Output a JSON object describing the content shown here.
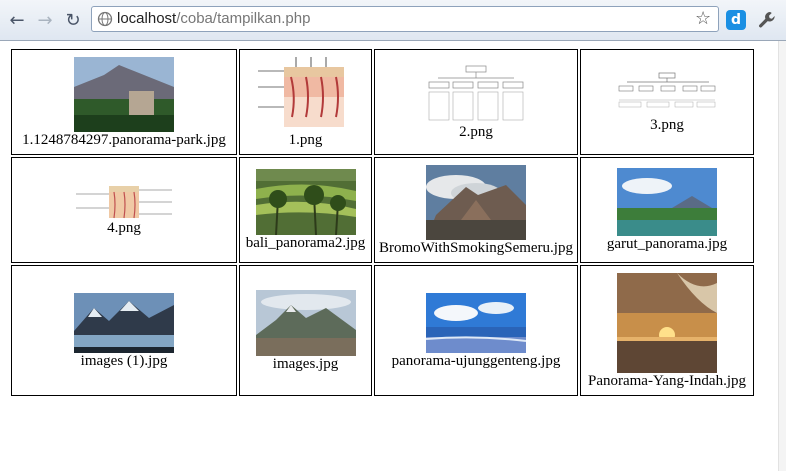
{
  "browser": {
    "back_icon": "arrow-left-icon",
    "forward_icon": "arrow-right-icon",
    "reload_icon": "reload-icon",
    "url_host": "localhost",
    "url_path": "/coba/tampilkan.php",
    "bookmark_icon": "star-icon",
    "extension_label": "d",
    "menu_icon": "wrench-icon"
  },
  "gallery": {
    "images": [
      {
        "caption": "1.1248784297.panorama-park.jpg",
        "kind": "photo"
      },
      {
        "caption": "1.png",
        "kind": "diagram"
      },
      {
        "caption": "2.png",
        "kind": "chart"
      },
      {
        "caption": "3.png",
        "kind": "chart"
      },
      {
        "caption": "4.png",
        "kind": "diagram"
      },
      {
        "caption": "bali_panorama2.jpg",
        "kind": "photo"
      },
      {
        "caption": "BromoWithSmokingSemeru.jpg",
        "kind": "photo"
      },
      {
        "caption": "garut_panorama.jpg",
        "kind": "photo"
      },
      {
        "caption": "images (1).jpg",
        "kind": "photo"
      },
      {
        "caption": "images.jpg",
        "kind": "photo"
      },
      {
        "caption": "panorama-ujunggenteng.jpg",
        "kind": "photo"
      },
      {
        "caption": "Panorama-Yang-Indah.jpg",
        "kind": "photo"
      }
    ]
  }
}
